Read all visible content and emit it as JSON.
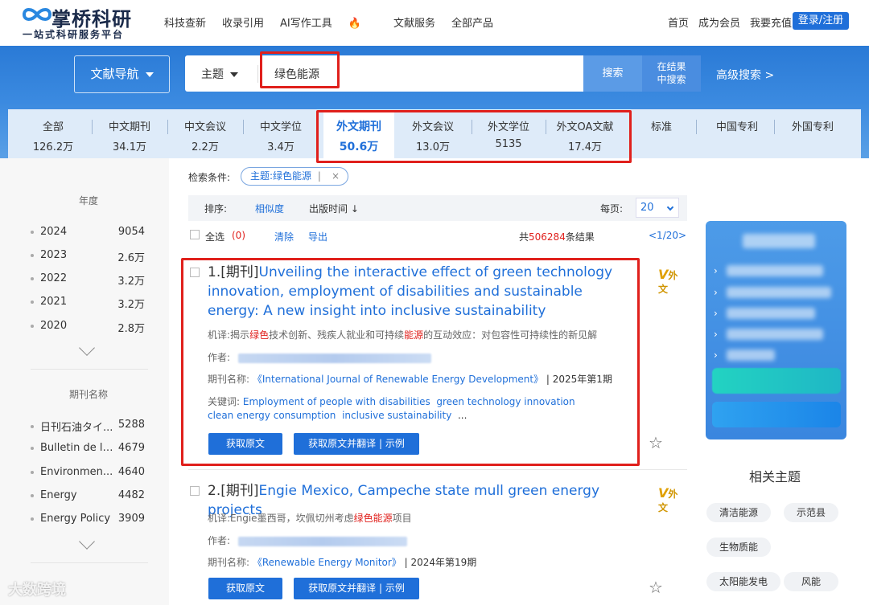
{
  "brand": {
    "title": "掌桥科研",
    "subtitle": "一站式科研服务平台"
  },
  "topnav": [
    {
      "label": "科技查新"
    },
    {
      "label": "收录引用"
    },
    {
      "label": "AI写作工具",
      "icon": "fire-icon"
    },
    {
      "label": "文献服务"
    },
    {
      "label": "全部产品"
    }
  ],
  "rightnav": {
    "home": "首页",
    "member": "成为会员",
    "recharge": "我要充值",
    "login": "登录/注册"
  },
  "search": {
    "nav_label": "文献导航",
    "type_label": "主题",
    "value": "绿色能源",
    "search_label": "搜索",
    "in_result_line1": "在结果",
    "in_result_line2": "中搜索",
    "advanced_label": "高级搜索 >"
  },
  "categories": [
    {
      "name": "全部",
      "count": "126.2万"
    },
    {
      "name": "中文期刊",
      "count": "34.1万"
    },
    {
      "name": "中文会议",
      "count": "2.2万"
    },
    {
      "name": "中文学位",
      "count": "3.4万"
    },
    {
      "name": "外文期刊",
      "count": "50.6万",
      "selected": true
    },
    {
      "name": "外文会议",
      "count": "13.0万"
    },
    {
      "name": "外文学位",
      "count": "5135"
    },
    {
      "name": "外文OA文献",
      "count": "17.4万"
    },
    {
      "name": "标准",
      "count": ""
    },
    {
      "name": "中国专利",
      "count": ""
    },
    {
      "name": "外国专利",
      "count": ""
    }
  ],
  "sidebar": {
    "year_title": "年度",
    "years": [
      {
        "name": "2024",
        "count": "9054"
      },
      {
        "name": "2023",
        "count": "2.6万"
      },
      {
        "name": "2022",
        "count": "3.2万"
      },
      {
        "name": "2021",
        "count": "3.2万"
      },
      {
        "name": "2020",
        "count": "2.8万"
      }
    ],
    "journal_title": "期刊名称",
    "journals": [
      {
        "name": "日刊石油タイ...",
        "count": "5288"
      },
      {
        "name": "Bulletin de l'...",
        "count": "4679"
      },
      {
        "name": "Environmen...",
        "count": "4640"
      },
      {
        "name": "Energy",
        "count": "4482"
      },
      {
        "name": "Energy Policy",
        "count": "3909"
      }
    ]
  },
  "conditions": {
    "label": "检索条件:",
    "tag": "主题:绿色能源",
    "tag_sep": "|",
    "tag_close": "×"
  },
  "sortbar": {
    "label": "排序:",
    "similarity": "相似度",
    "time": "出版时间 ↓",
    "per_page_label": "每页:",
    "per_page_value": "20"
  },
  "selectbar": {
    "select_all": "全选",
    "selected_count": "(0)",
    "clear": "清除",
    "export": "导出",
    "total_prefix": "共",
    "total": "506284",
    "total_suffix": "条结果",
    "pager": "<1/20>"
  },
  "results": [
    {
      "index": "1.",
      "type": "[期刊]",
      "title": "Unveiling the interactive effect of green technology innovation, employment of disabilities and sustainable energy: A new insight into inclusive sustainability",
      "badge": "外文",
      "abstract_label": "机译:",
      "abstract_parts": [
        "揭示",
        "绿色",
        "技术创新、残疾人就业和可持续",
        "能源",
        "的互动效应：对包容性可持续性的新见解"
      ],
      "author_label": "作者:",
      "journal_label": "期刊名称:",
      "journal": "《International Journal of Renewable Energy Development》",
      "issue": "| 2025年第1期",
      "keywords_label": "关键词:",
      "keywords_line1": [
        "Employment of people with disabilities",
        "green technology innovation"
      ],
      "keywords_line2": [
        "clean energy consumption",
        "inclusive sustainability"
      ],
      "keywords_more": "...",
      "btn_original": "获取原文",
      "btn_translate": "获取原文并翻译 | 示例"
    },
    {
      "index": "2.",
      "type": "[期刊]",
      "title": "Engie Mexico, Campeche state mull green energy projects",
      "badge": "外文",
      "abstract_label": "机译:",
      "abstract_parts": [
        "Engie墨西哥，坎佩切州考虑",
        "绿色能源",
        "项目"
      ],
      "author_label": "作者:",
      "journal_label": "期刊名称:",
      "journal": "《Renewable Energy Monitor》",
      "issue": "| 2024年第19期",
      "btn_original": "获取原文",
      "btn_translate": "获取原文并翻译 | 示例"
    }
  ],
  "related": {
    "title": "相关主题",
    "chips": [
      "清洁能源",
      "示范县",
      "生物质能",
      "太阳能发电",
      "风能"
    ]
  },
  "watermark": "大数跨境",
  "colors": {
    "brand_blue": "#1f6fd9",
    "highlight_red": "#e0201c",
    "band_blue": "#2a7ad6"
  }
}
